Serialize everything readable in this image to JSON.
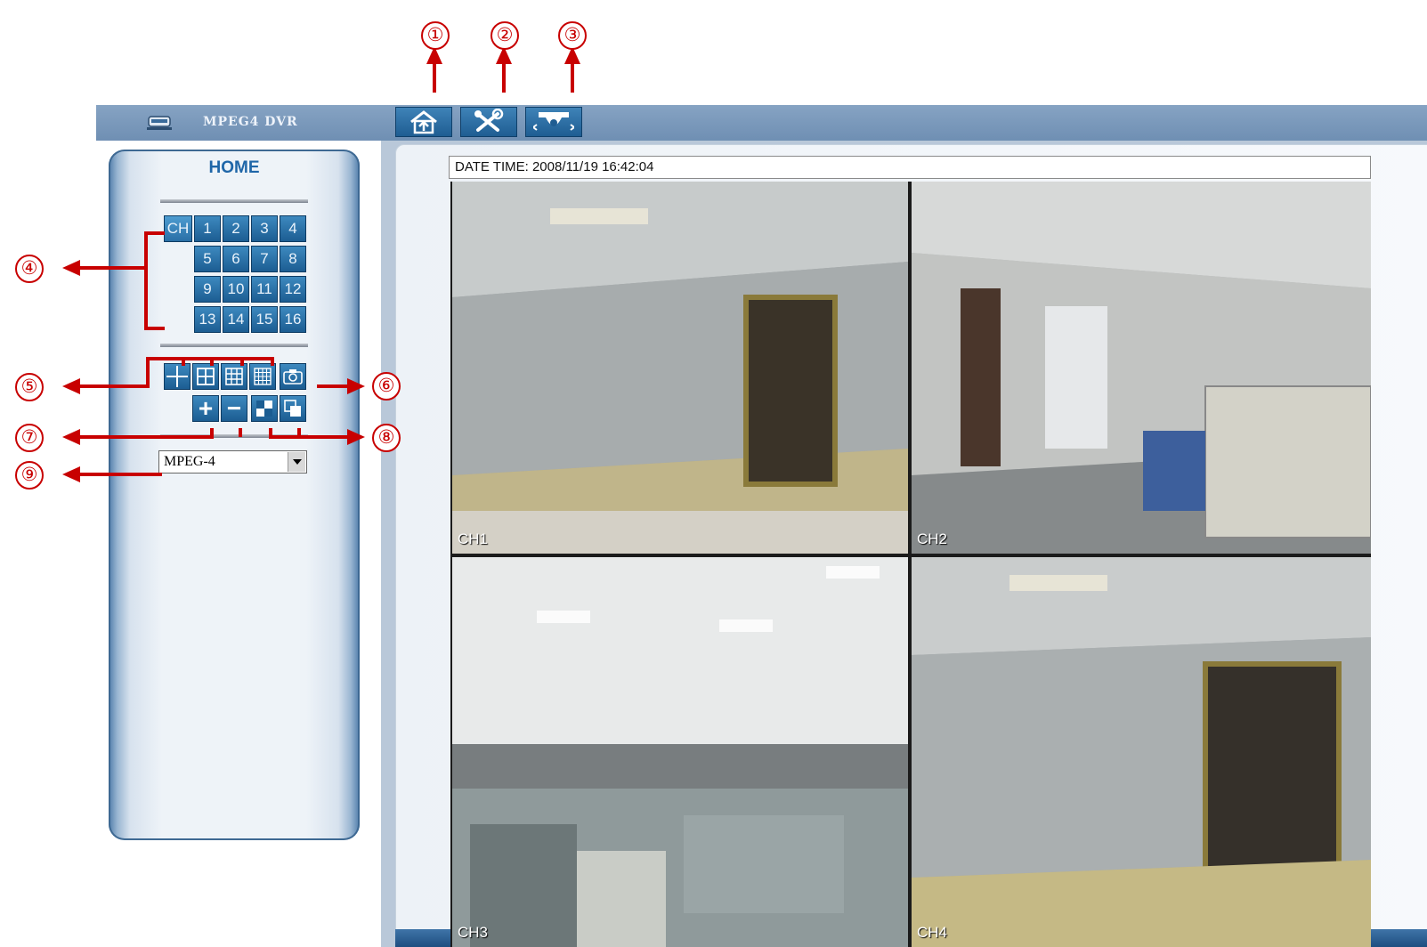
{
  "app": {
    "title": "MPEG4 DVR",
    "icon": "dvr-device-icon"
  },
  "toolbar": {
    "buttons": [
      {
        "name": "home",
        "icon": "home-icon"
      },
      {
        "name": "config",
        "icon": "tools-icon"
      },
      {
        "name": "ptz",
        "icon": "ptz-camera-icon"
      }
    ]
  },
  "sidebar": {
    "title": "HOME",
    "channel_label": "CH",
    "channels": [
      "1",
      "2",
      "3",
      "4",
      "5",
      "6",
      "7",
      "8",
      "9",
      "10",
      "11",
      "12",
      "13",
      "14",
      "15",
      "16"
    ],
    "layout_buttons": [
      {
        "name": "single-view",
        "icon": "single-view-icon"
      },
      {
        "name": "quad-view",
        "icon": "quad-view-icon"
      },
      {
        "name": "nine-view",
        "icon": "nine-view-icon"
      },
      {
        "name": "sixteen-view",
        "icon": "sixteen-view-icon"
      }
    ],
    "snapshot_icon": "snapshot-camera-icon",
    "zoom_in": "+",
    "zoom_out": "−",
    "quality_icons": [
      "quality-a-icon",
      "quality-b-icon"
    ],
    "format_select": {
      "value": "MPEG-4",
      "options": [
        "MPEG-4"
      ]
    }
  },
  "main": {
    "datetime": "DATE TIME: 2008/11/19 16:42:04",
    "channels": [
      {
        "label": "CH1"
      },
      {
        "label": "CH2"
      },
      {
        "label": "CH3"
      },
      {
        "label": "CH4"
      }
    ]
  },
  "callouts": [
    "①",
    "②",
    "③",
    "④",
    "⑤",
    "⑥",
    "⑦",
    "⑧",
    "⑨"
  ],
  "colors": {
    "accent_blue": "#1f66a8",
    "button_blue": "#2a6fa6",
    "callout_red": "#c80000"
  }
}
